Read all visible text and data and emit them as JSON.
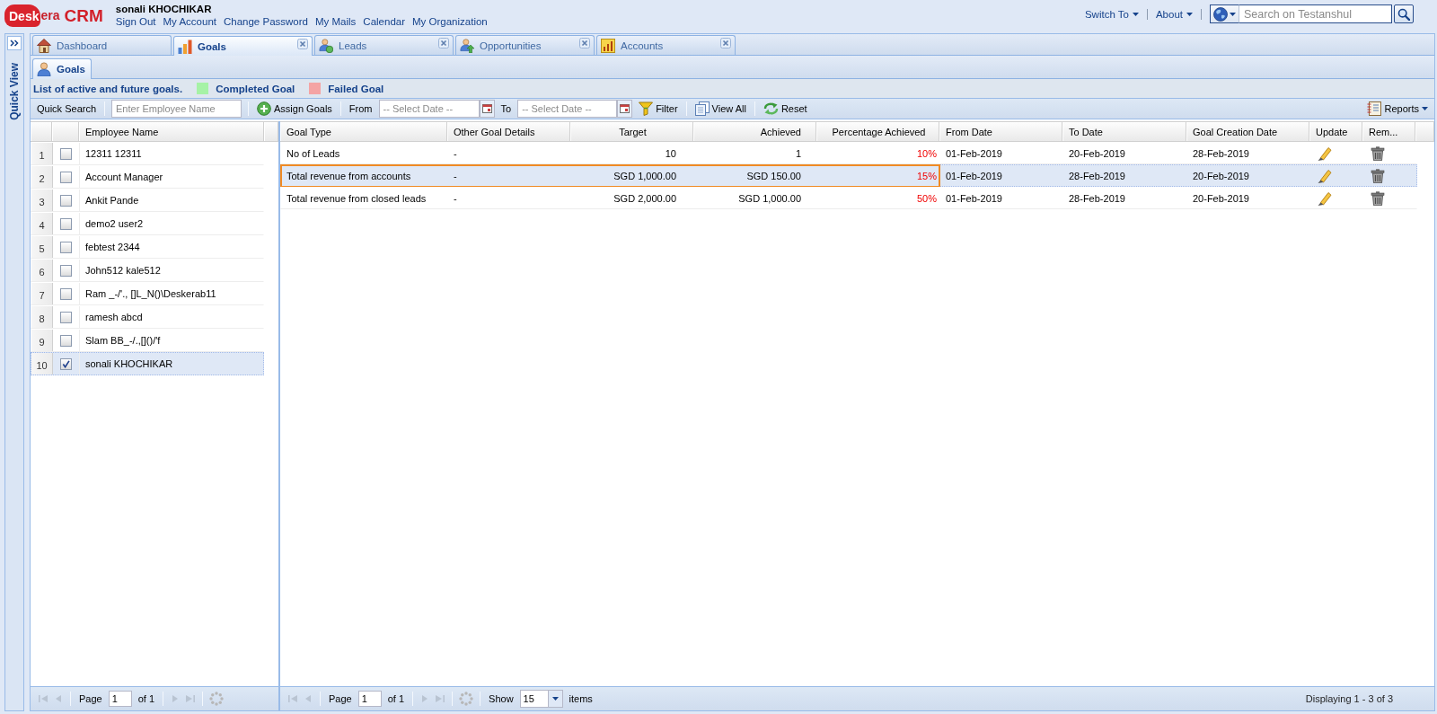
{
  "header": {
    "logo": {
      "cloud_text": "Desk",
      "text": "era"
    },
    "product": "CRM",
    "user_name": "sonali KHOCHIKAR",
    "links": [
      "Sign Out",
      "My Account",
      "Change Password",
      "My Mails",
      "Calendar",
      "My Organization"
    ],
    "menus": [
      "Switch To",
      "About"
    ],
    "search": {
      "placeholder": "Search on Testanshul"
    }
  },
  "quick_view": {
    "title": "Quick View"
  },
  "tabs": [
    {
      "label": "Dashboard",
      "selected": false,
      "closable": false
    },
    {
      "label": "Goals",
      "selected": true,
      "closable": true
    },
    {
      "label": "Leads",
      "selected": false,
      "closable": true
    },
    {
      "label": "Opportunities",
      "selected": false,
      "closable": true
    },
    {
      "label": "Accounts",
      "selected": false,
      "closable": true
    }
  ],
  "subtabs": [
    {
      "label": "Goals",
      "selected": true
    }
  ],
  "legend": {
    "caption": "List of active and future goals.",
    "items": [
      {
        "label": "Completed Goal",
        "color": "#a6f2a6"
      },
      {
        "label": "Failed Goal",
        "color": "#f4a4a4"
      }
    ]
  },
  "toolbar": {
    "quick_search_label": "Quick Search",
    "employee_search": {
      "placeholder": "Enter Employee Name"
    },
    "assign_button": "Assign Goals",
    "from_label": "From",
    "from_date": {
      "placeholder": "-- Select Date --"
    },
    "to_label": "To",
    "to_date": {
      "placeholder": "-- Select Date --"
    },
    "filter_button": "Filter",
    "view_all_button": "View All",
    "reset_button": "Reset",
    "reports_button": "Reports"
  },
  "employees": {
    "columns": [
      "Employee Name"
    ],
    "rows": [
      {
        "number": "1",
        "name": "12311 12311",
        "checked": false,
        "selected": false
      },
      {
        "number": "2",
        "name": "Account Manager",
        "checked": false,
        "selected": false
      },
      {
        "number": "3",
        "name": "Ankit Pande",
        "checked": false,
        "selected": false
      },
      {
        "number": "4",
        "name": "demo2 user2",
        "checked": false,
        "selected": false
      },
      {
        "number": "5",
        "name": "febtest 2344",
        "checked": false,
        "selected": false
      },
      {
        "number": "6",
        "name": "John512 kale512",
        "checked": false,
        "selected": false
      },
      {
        "number": "7",
        "name": "Ram _-/'., []L_N()\\Deskerab11",
        "checked": false,
        "selected": false
      },
      {
        "number": "8",
        "name": "ramesh abcd",
        "checked": false,
        "selected": false
      },
      {
        "number": "9",
        "name": "Slam BB_-/.,[]()/'f",
        "checked": false,
        "selected": false
      },
      {
        "number": "10",
        "name": "sonali KHOCHIKAR",
        "checked": true,
        "selected": true
      }
    ],
    "paging": {
      "page_label": "Page",
      "page": "1",
      "of_label": "of 1",
      "navigation_disabled": true
    }
  },
  "goals": {
    "columns": [
      "Goal Type",
      "Other Goal Details",
      "Target",
      "Achieved",
      "Percentage Achieved",
      "From Date",
      "To Date",
      "Goal Creation Date",
      "Update",
      "Rem..."
    ],
    "rows": [
      {
        "goal_type": "No of Leads",
        "details": "-",
        "target": "10",
        "achieved": "1",
        "percentage": "10%",
        "from_date": "01-Feb-2019",
        "to_date": "20-Feb-2019",
        "created": "28-Feb-2019",
        "selected": false,
        "outlined": false
      },
      {
        "goal_type": "Total revenue from accounts",
        "details": "-",
        "target": "SGD 1,000.00",
        "achieved": "SGD 150.00",
        "percentage": "15%",
        "from_date": "01-Feb-2019",
        "to_date": "28-Feb-2019",
        "created": "20-Feb-2019",
        "selected": true,
        "outlined": true
      },
      {
        "goal_type": "Total revenue from closed leads",
        "details": "-",
        "target": "SGD 2,000.00",
        "achieved": "SGD 1,000.00",
        "percentage": "50%",
        "from_date": "01-Feb-2019",
        "to_date": "28-Feb-2019",
        "created": "20-Feb-2019",
        "selected": false,
        "outlined": false
      }
    ],
    "paging": {
      "page_label": "Page",
      "page": "1",
      "of_label": "of 1",
      "navigation_disabled": true,
      "show_label": "Show",
      "page_size": "15",
      "items_label": "items",
      "summary": "Displaying 1 - 3 of 3"
    }
  }
}
